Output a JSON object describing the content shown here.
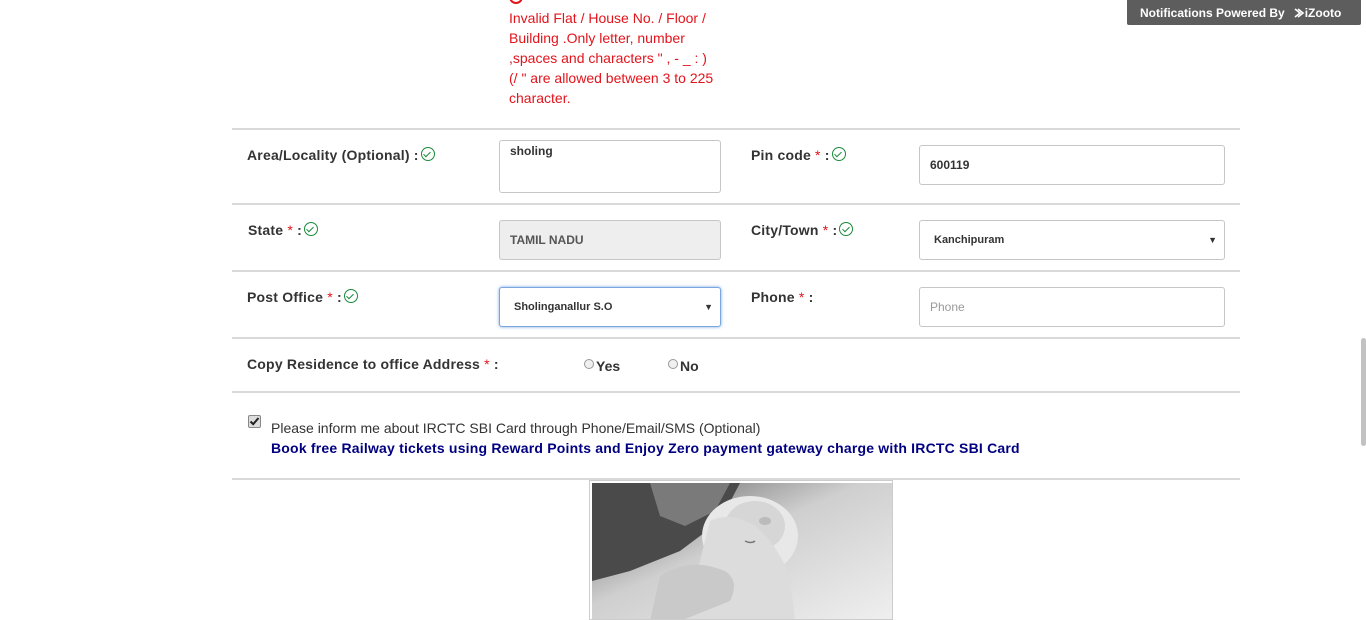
{
  "error": {
    "message": "Invalid Flat / House No. / Floor / Building .Only letter, number ,spaces and characters \" , - _ : ) (/ \" are allowed between 3 to 225 character."
  },
  "form": {
    "area": {
      "label": "Area/Locality (Optional) :",
      "value": "sholing"
    },
    "pincode": {
      "label": "Pin code",
      "required": "*",
      "suffix": ":",
      "value": "600119"
    },
    "state": {
      "label": "State",
      "required": "*",
      "suffix": ":",
      "value": "TAMIL NADU"
    },
    "city": {
      "label": "City/Town",
      "required": "*",
      "suffix": ":",
      "value": "Kanchipuram"
    },
    "post_office": {
      "label": "Post Office",
      "required": "*",
      "suffix": ":",
      "value": "Sholinganallur S.O"
    },
    "phone": {
      "label": "Phone",
      "required": "*",
      "suffix": ":",
      "placeholder": "Phone"
    },
    "copy_address": {
      "label": "Copy Residence to office Address",
      "required": "*",
      "suffix": ":",
      "yes": "Yes",
      "no": "No"
    },
    "consent": {
      "text": "Please inform me about IRCTC SBI Card through Phone/Email/SMS (Optional)",
      "promo": "Book free Railway tickets using Reward Points and Enjoy Zero payment gateway charge with IRCTC SBI Card",
      "checked": true
    }
  },
  "notification": {
    "text": "Notifications Powered By",
    "brand": "iZooto"
  },
  "colors": {
    "error": "#e3131b",
    "valid": "#1a8a3a",
    "promo": "#000080",
    "focus": "#7aa7e0"
  }
}
